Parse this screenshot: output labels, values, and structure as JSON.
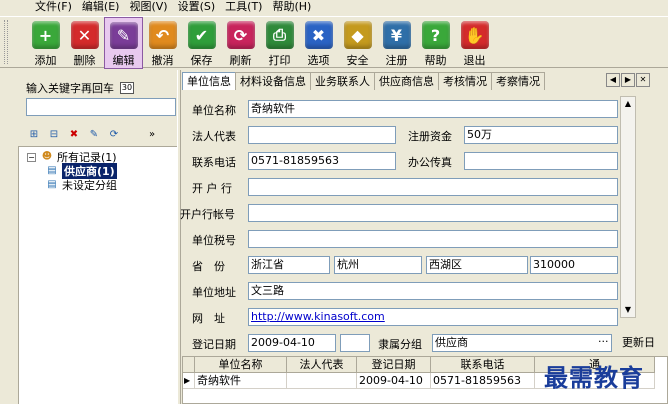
{
  "menu": [
    "文件(F)",
    "编辑(E)",
    "视图(V)",
    "设置(S)",
    "工具(T)",
    "帮助(H)"
  ],
  "toolbar": [
    {
      "label": "添加",
      "icon": "add-icon",
      "color": "#3aa83a",
      "glyph": "+"
    },
    {
      "label": "删除",
      "icon": "delete-icon",
      "color": "#d42b2b",
      "glyph": "✕"
    },
    {
      "label": "编辑",
      "icon": "edit-icon",
      "color": "#7a3d98",
      "glyph": "✎"
    },
    {
      "label": "撤消",
      "icon": "undo-icon",
      "color": "#e08a1e",
      "glyph": "↶"
    },
    {
      "label": "保存",
      "icon": "save-icon",
      "color": "#2f9e3a",
      "glyph": "✔"
    },
    {
      "label": "刷新",
      "icon": "refresh-icon",
      "color": "#c8245c",
      "glyph": "⟳"
    },
    {
      "label": "打印",
      "icon": "print-icon",
      "color": "#2f8a3a",
      "glyph": "⎙"
    },
    {
      "label": "选项",
      "icon": "options-icon",
      "color": "#2a63c4",
      "glyph": "✖"
    },
    {
      "label": "安全",
      "icon": "security-icon",
      "color": "#c49a1e",
      "glyph": "◆"
    },
    {
      "label": "注册",
      "icon": "register-icon",
      "color": "#2f6fa8",
      "glyph": "¥"
    },
    {
      "label": "帮助",
      "icon": "help-icon",
      "color": "#3aa83a",
      "glyph": "?"
    },
    {
      "label": "退出",
      "icon": "exit-icon",
      "color": "#d42b2b",
      "glyph": "✋"
    }
  ],
  "left": {
    "search_label": "输入关键字再回车",
    "cal_text": "30",
    "search_value": "",
    "tree": {
      "root": "所有记录(1)",
      "child_selected": "供应商(1)",
      "child2": "未设定分组"
    }
  },
  "tabs": [
    "单位信息",
    "材料设备信息",
    "业务联系人",
    "供应商信息",
    "考核情况",
    "考察情况"
  ],
  "form": {
    "unit_name_label": "单位名称",
    "unit_name": "奇纳软件",
    "legal_rep_label": "法人代表",
    "legal_rep": "",
    "reg_capital_label": "注册资金",
    "reg_capital": "50万",
    "phone_label": "联系电话",
    "phone": "0571-81859563",
    "fax_label": "办公传真",
    "fax": "",
    "bank_label": "开 户 行",
    "bank": "",
    "account_label": "开户行帐号",
    "account": "",
    "tax_label": "单位税号",
    "tax": "",
    "province_label": "省　份",
    "province": "浙江省",
    "city": "杭州",
    "district": "西湖区",
    "postcode": "310000",
    "address_label": "单位地址",
    "address": "文三路",
    "website_label": "网　址",
    "website": "http://www.kinasoft.com",
    "reg_date_label": "登记日期",
    "reg_date": "2009-04-10",
    "group_label": "隶属分组",
    "group": "供应商",
    "group_btn": "···",
    "update_label": "更新日"
  },
  "grid": {
    "headers": [
      "单位名称",
      "法人代表",
      "登记日期",
      "联系电话",
      "通"
    ],
    "rows": [
      [
        "奇纳软件",
        "",
        "2009-04-10",
        "0571-81859563",
        ""
      ]
    ]
  },
  "watermark": "最需教育"
}
